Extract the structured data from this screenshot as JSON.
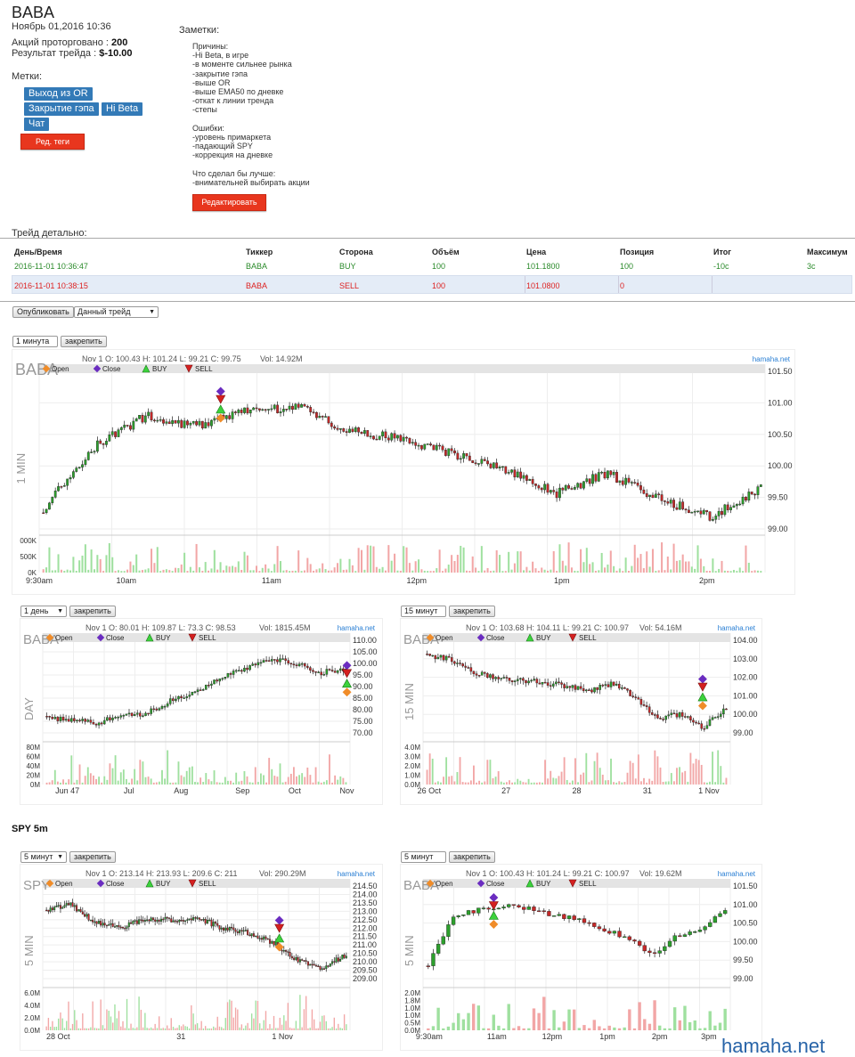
{
  "header": {
    "ticker": "BABA",
    "datetime": "Ноябрь 01,2016 10:36",
    "shares_label": "Акций проторговано :",
    "shares_value": "200",
    "result_label": "Результат трейда :",
    "result_value": "$-10.00"
  },
  "tags": {
    "label": "Метки:",
    "items": [
      "Выход из OR",
      "Закрытие гэпа",
      "Hi Beta",
      "Чат"
    ],
    "edit_button": "Ред. теги"
  },
  "notes": {
    "label": "Заметки:",
    "text": "Причины:\n-Hi Beta, в игре\n-в моменте сильнее рынка\n-закрытие гэпа\n-выше OR\n-выше EMA50 по дневке\n-откат к линии тренда\n-степы\n\nОшибки:\n-уровень примаркета\n-падающий SPY\n-коррекция на дневке\n\nЧто сделал бы лучше:\n-внимательней выбирать акции",
    "edit_button": "Редактировать"
  },
  "trade_detail": {
    "label": "Трейд детально:",
    "columns": [
      "День/Время",
      "Тиккер",
      "Сторона",
      "Объём",
      "Цена",
      "Позиция",
      "Итог",
      "Максимум"
    ],
    "rows": [
      [
        "2016-11-01 10:36:47",
        "BABA",
        "BUY",
        "100",
        "101.1800",
        "100",
        "-10c",
        "3c"
      ],
      [
        "2016-11-01 10:38:15",
        "BABA",
        "SELL",
        "100",
        "101.0800",
        "0",
        "",
        ""
      ]
    ]
  },
  "controls": {
    "publish_button": "Опубликовать",
    "scope_select": "Данный трейд",
    "pin_button": "закрепить"
  },
  "legend": {
    "open": "Open",
    "close": "Close",
    "buy": "BUY",
    "sell": "SELL"
  },
  "colors": {
    "up": "#2ca02c",
    "down": "#c62828",
    "open_marker": "#f08c28",
    "close_marker": "#6a2cc0",
    "buy_marker": "#3cd23c",
    "sell_marker": "#d42020",
    "accent": "#337ab7",
    "danger": "#e8361e"
  },
  "spy_section": {
    "label": "SPY 5m"
  },
  "charts": [
    {
      "id": "main1m",
      "interval": "1 минута",
      "symbol": "BABA",
      "ohlc": "Nov 1 O: 100.43 H: 101.24 L: 99.21 C: 99.75",
      "vol": "Vol: 14.92M",
      "source": "hamaha.net",
      "side_label": "1 MIN",
      "y_ticks": [
        "101.50",
        "101.00",
        "100.50",
        "100.00",
        "99.50",
        "99.00"
      ],
      "vol_ticks": [
        "000K",
        "500K",
        "0K"
      ],
      "x_ticks": [
        "9:30am",
        "10am",
        "11am",
        "12pm",
        "1pm",
        "2pm"
      ]
    },
    {
      "id": "day",
      "interval": "1 день",
      "symbol": "BABA",
      "ohlc": "Nov 1 O: 80.01 H: 109.87 L: 73.3 C: 98.53",
      "vol": "Vol: 1815.45M",
      "source": "hamaha.net",
      "side_label": "DAY",
      "y_ticks": [
        "110.00",
        "105.00",
        "100.00",
        "95.00",
        "90.00",
        "85.00",
        "80.00",
        "75.00",
        "70.00"
      ],
      "vol_ticks": [
        "80M",
        "60M",
        "40M",
        "20M",
        "0M"
      ],
      "x_ticks": [
        "Jun 47",
        "Jul",
        "Aug",
        "Sep",
        "Oct",
        "Nov"
      ]
    },
    {
      "id": "m15",
      "interval": "15 минут",
      "symbol": "BABA",
      "ohlc": "Nov 1 O: 103.68 H: 104.11 L: 99.21 C: 100.97",
      "vol": "Vol: 54.16M",
      "source": "hamaha.net",
      "side_label": "15 MIN",
      "y_ticks": [
        "104.00",
        "103.00",
        "102.00",
        "101.00",
        "100.00",
        "99.00"
      ],
      "vol_ticks": [
        "4.0M",
        "3.0M",
        "2.0M",
        "1.0M",
        "0.0M"
      ],
      "x_ticks": [
        "26 Oct",
        "27",
        "28",
        "31",
        "1 Nov"
      ]
    },
    {
      "id": "spy5",
      "interval": "5 минут",
      "symbol": "SPY",
      "ohlc": "Nov 1 O: 213.14 H: 213.93 L: 209.6 C: 211",
      "vol": "Vol: 290.29M",
      "source": "hamaha.net",
      "side_label": "5 MIN",
      "y_ticks": [
        "214.50",
        "214.00",
        "213.50",
        "213.00",
        "212.50",
        "212.00",
        "211.50",
        "211.00",
        "210.50",
        "210.00",
        "209.50",
        "209.00"
      ],
      "vol_ticks": [
        "6.0M",
        "4.0M",
        "2.0M",
        "0.0M"
      ],
      "x_ticks": [
        "28 Oct",
        "31",
        "1 Nov"
      ]
    },
    {
      "id": "baba5",
      "interval": "5 минут",
      "symbol": "BABA",
      "ohlc": "Nov 1 O: 100.43 H: 101.24 L: 99.21 C: 100.97",
      "vol": "Vol: 19.62M",
      "source": "hamaha.net",
      "side_label": "5 MIN",
      "y_ticks": [
        "101.50",
        "101.00",
        "100.50",
        "100.00",
        "99.50",
        "99.00"
      ],
      "vol_ticks": [
        "2.0M",
        "1.8M",
        "1.0M",
        "1.0M",
        "0.5M",
        "0.0M"
      ],
      "x_ticks": [
        "9:30am",
        "11am",
        "12pm",
        "1pm",
        "2pm",
        "3pm"
      ]
    }
  ],
  "watermark": "hamaha.net"
}
